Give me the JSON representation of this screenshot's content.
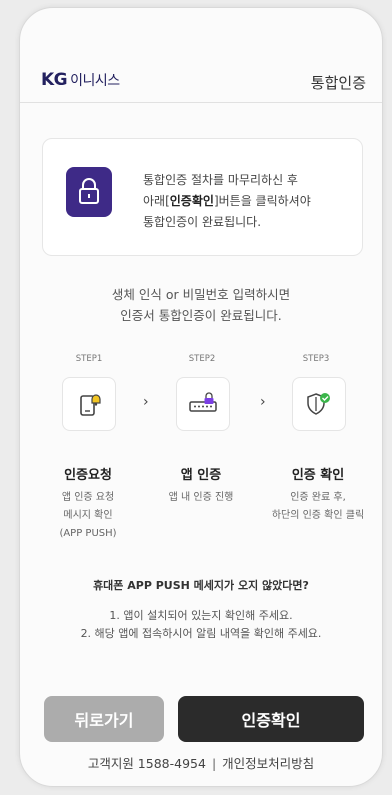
{
  "header": {
    "logo_brand": "KG",
    "logo_name": "이니시스",
    "title": "통합인증"
  },
  "notice": {
    "icon": "lock-icon",
    "line1": "통합인증 절차를 마무리하신 후",
    "line2_prefix": "아래[",
    "line2_bold": "인증확인",
    "line2_suffix": "]버튼을 클릭하셔야",
    "line3": "통합인증이 완료됩니다."
  },
  "bio": {
    "line1": "생체 인식 or 비밀번호 입력하시면",
    "line2": "인증서 통합인증이 완료됩니다."
  },
  "steps": [
    {
      "label": "STEP1",
      "icon": "phone-notification-icon",
      "title": "인증요청",
      "desc": [
        "앱 인증 요청",
        "메시지 확인",
        "(APP PUSH)"
      ]
    },
    {
      "label": "STEP2",
      "icon": "password-lock-icon",
      "title": "앱 인증",
      "desc": [
        "앱 내 인증 진행"
      ]
    },
    {
      "label": "STEP3",
      "icon": "shield-check-icon",
      "title": "인증 확인",
      "desc": [
        "인증 완료 후,",
        "하단의 인증 확인 클릭"
      ]
    }
  ],
  "step_separator": "›",
  "push_help": {
    "question": "휴대폰 APP PUSH 메세지가 오지 않았다면?",
    "items": [
      "1. 앱이 설치되어 있는지 확인해 주세요.",
      "2. 해당 앱에 접속하시어 알림 내역을 확인해 주세요."
    ]
  },
  "buttons": {
    "back": "뒤로가기",
    "confirm": "인증확인"
  },
  "footer": {
    "support": "고객지원 1588-4954",
    "separator": "|",
    "privacy": "개인정보처리방침"
  },
  "colors": {
    "brand": "#3e2a87",
    "confirm_button": "#2b2b2b",
    "back_button": "#acacac"
  }
}
